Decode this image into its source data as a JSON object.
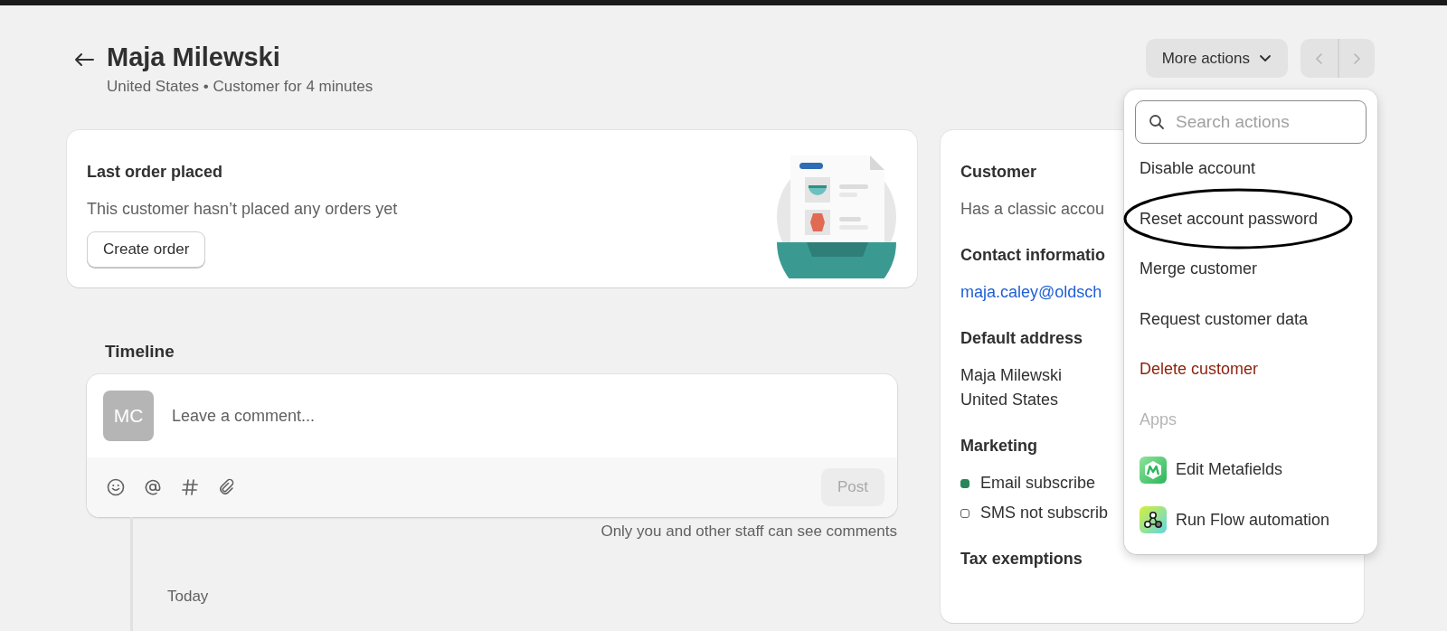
{
  "header": {
    "title": "Maja Milewski",
    "subtitle": "United States • Customer for 4 minutes",
    "more_actions": "More actions"
  },
  "last_order": {
    "title": "Last order placed",
    "text": "This customer hasn’t placed any orders yet",
    "button": "Create order"
  },
  "timeline": {
    "title": "Timeline",
    "avatar": "MC",
    "placeholder": "Leave a comment...",
    "post": "Post",
    "note": "Only you and other staff can see comments",
    "day": "Today"
  },
  "customer_card": {
    "customer_title": "Customer",
    "customer_text": "Has a classic accou",
    "contact_title": "Contact informatio",
    "email": "maja.caley@oldsch",
    "address_title": "Default address",
    "address_lines": [
      "Maja Milewski",
      "United States"
    ],
    "marketing_title": "Marketing",
    "marketing": [
      {
        "label": "Email subscribe",
        "subscribed": true
      },
      {
        "label": "SMS not subscrib",
        "subscribed": false
      }
    ],
    "tax_title": "Tax exemptions"
  },
  "menu": {
    "search_placeholder": "Search actions",
    "items": [
      {
        "kind": "action",
        "label": "Disable account",
        "circled": false
      },
      {
        "kind": "action",
        "label": "Reset account password",
        "circled": true
      },
      {
        "kind": "action",
        "label": "Merge customer",
        "circled": false
      },
      {
        "kind": "action",
        "label": "Request customer data",
        "circled": false
      },
      {
        "kind": "destructive",
        "label": "Delete customer",
        "circled": false
      },
      {
        "kind": "section",
        "label": "Apps",
        "circled": false
      },
      {
        "kind": "app",
        "label": "Edit Metafields",
        "circled": false
      },
      {
        "kind": "app",
        "label": "Run Flow automation",
        "circled": false
      }
    ]
  }
}
